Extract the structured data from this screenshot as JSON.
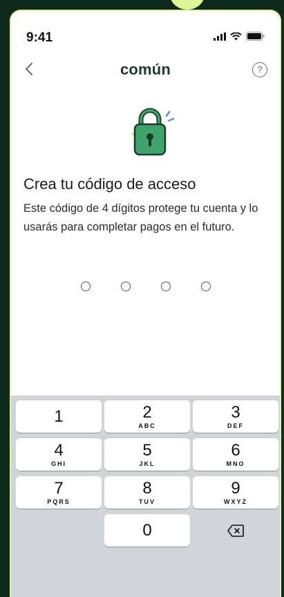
{
  "status": {
    "time": "9:41"
  },
  "nav": {
    "brand": "común",
    "back_icon": "chevron-left-icon",
    "help_icon": "question-icon",
    "help_label": "?"
  },
  "content": {
    "heading": "Crea tu código de acceso",
    "description": "Este código de 4 dígitos protege tu cuenta y lo usarás para completar pagos en el futuro.",
    "pin_length": 4,
    "pin_filled": 0
  },
  "keypad": {
    "keys": [
      {
        "num": "1",
        "letters": ""
      },
      {
        "num": "2",
        "letters": "ABC"
      },
      {
        "num": "3",
        "letters": "DEF"
      },
      {
        "num": "4",
        "letters": "GHI"
      },
      {
        "num": "5",
        "letters": "JKL"
      },
      {
        "num": "6",
        "letters": "MNO"
      },
      {
        "num": "7",
        "letters": "PQRS"
      },
      {
        "num": "8",
        "letters": "TUV"
      },
      {
        "num": "9",
        "letters": "WXYZ"
      },
      {
        "num": "0",
        "letters": ""
      }
    ],
    "delete_icon": "backspace-icon"
  },
  "colors": {
    "brand": "#1a3a2a",
    "lock_green": "#3fa36b",
    "frame_accent": "#dff59a",
    "keypad_bg": "#d2d4da"
  }
}
